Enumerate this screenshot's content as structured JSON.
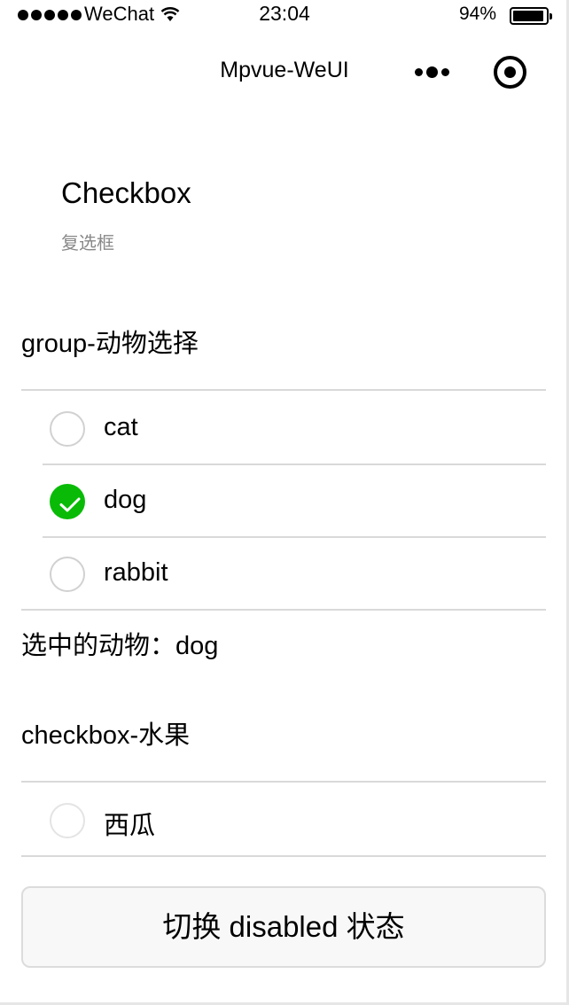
{
  "status_bar": {
    "carrier": "WeChat",
    "time": "23:04",
    "battery_percent": "94%",
    "battery_level": 0.94,
    "signal_icon": "signal-dots-icon",
    "wifi_icon": "wifi-icon"
  },
  "nav": {
    "title": "Mpvue-WeUI",
    "more_icon": "more-dots-icon",
    "close_icon": "capsule-close-icon"
  },
  "page": {
    "title": "Checkbox",
    "desc": "复选框"
  },
  "group": {
    "title": "group-动物选择",
    "items": [
      {
        "label": "cat",
        "checked": false
      },
      {
        "label": "dog",
        "checked": true
      },
      {
        "label": "rabbit",
        "checked": false
      }
    ],
    "selected_text": "选中的动物：dog"
  },
  "fruit": {
    "title": "checkbox-水果",
    "items": [
      {
        "label": "西瓜",
        "checked": false
      }
    ]
  },
  "toggle_button": "切换 disabled 状态",
  "colors": {
    "checked": "#09bb07",
    "divider": "#d9d9d9",
    "desc_text": "#888888"
  }
}
